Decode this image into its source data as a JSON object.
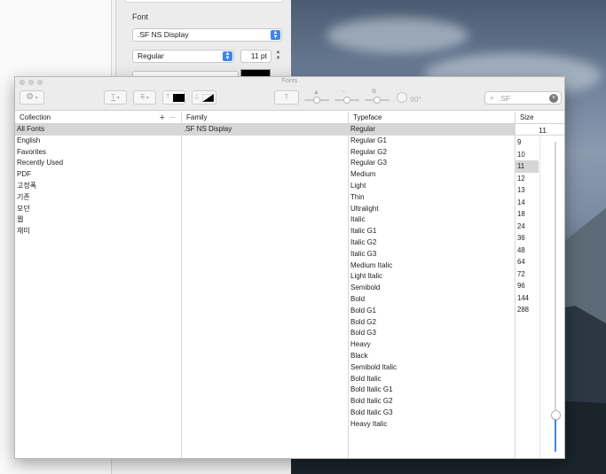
{
  "back_panel": {
    "font_label": "Font",
    "font_family_value": ".SF NS Display",
    "font_style_value": "Regular",
    "font_size_value": "11 pt"
  },
  "window": {
    "title": "Fonts"
  },
  "toolbar": {
    "angle_value": "90°",
    "search_value": ".SF"
  },
  "columns": {
    "collection_header": "Collection",
    "family_header": "Family",
    "typeface_header": "Typeface",
    "size_header": "Size"
  },
  "collections": [
    "All Fonts",
    "English",
    "Favorites",
    "Recently Used",
    "PDF",
    "고정폭",
    "기존",
    "모던",
    "웹",
    "재미"
  ],
  "selected_collection": 0,
  "families": [
    ".SF NS Display"
  ],
  "selected_family": 0,
  "typefaces": [
    "Regular",
    "Regular G1",
    "Regular G2",
    "Regular G3",
    "Medium",
    "Light",
    "Thin",
    "Ultralight",
    "Italic",
    "Italic G1",
    "Italic G2",
    "Italic G3",
    "Medium Italic",
    "Light Italic",
    "Semibold",
    "Bold",
    "Bold G1",
    "Bold G2",
    "Bold G3",
    "Heavy",
    "Black",
    "Semibold Italic",
    "Bold Italic",
    "Bold Italic G1",
    "Bold Italic G2",
    "Bold Italic G3",
    "Heavy Italic"
  ],
  "selected_typeface": 0,
  "size": {
    "current": "11",
    "options": [
      "9",
      "10",
      "11",
      "12",
      "13",
      "14",
      "18",
      "24",
      "36",
      "48",
      "64",
      "72",
      "96",
      "144",
      "288"
    ],
    "selected_index": 2,
    "slider_level": 0.12
  },
  "colors": {
    "accent": "#3d86e8",
    "selection": "#d6d6d6"
  }
}
